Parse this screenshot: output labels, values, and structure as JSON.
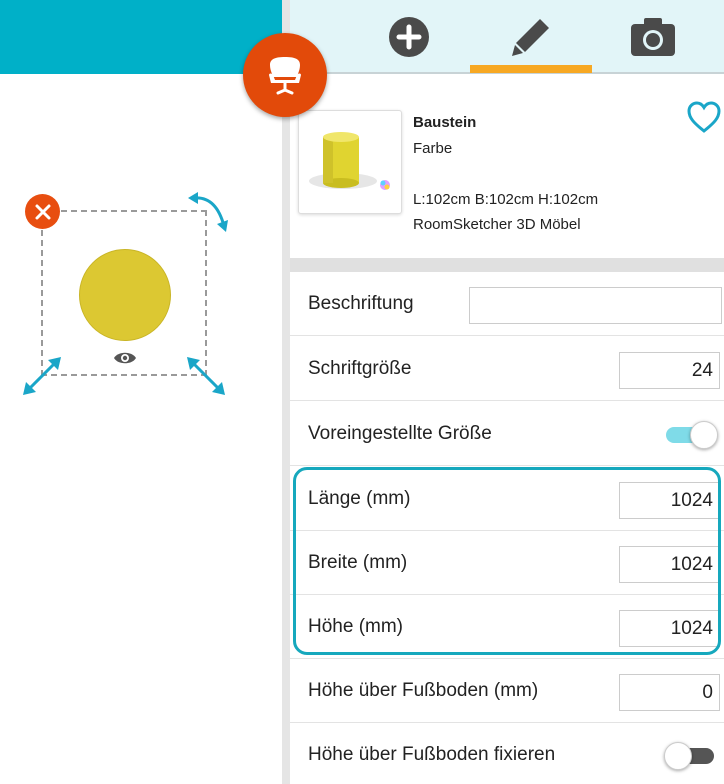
{
  "tabs": [
    {
      "icon": "plus-icon"
    },
    {
      "icon": "pencil-icon",
      "active": true
    },
    {
      "icon": "camera-icon"
    }
  ],
  "item": {
    "title": "Baustein",
    "subtitle": "Farbe",
    "dimensions": "L:102cm B:102cm H:102cm",
    "source": "RoomSketcher 3D Möbel",
    "color": "#dcc832"
  },
  "properties": {
    "beschriftung": {
      "label": "Beschriftung",
      "value": ""
    },
    "schriftgroesse": {
      "label": "Schriftgröße",
      "value": "24"
    },
    "voreingestellte_groesse": {
      "label": "Voreingestellte Größe",
      "toggle": true
    },
    "laenge": {
      "label": "Länge (mm)",
      "value": "1024"
    },
    "breite": {
      "label": "Breite (mm)",
      "value": "1024"
    },
    "hoehe": {
      "label": "Höhe (mm)",
      "value": "1024"
    },
    "hoehe_ueber_fussboden": {
      "label": "Höhe über Fußboden (mm)",
      "value": "0"
    },
    "hoehe_fixieren": {
      "label": "Höhe über Fußboden fixieren",
      "toggle": false
    }
  },
  "colors": {
    "accent": "#00b0c8",
    "active_tab": "#f7a823",
    "delete": "#e84e10",
    "furniture_button": "#e24a0a",
    "highlight": "#16a8bd"
  }
}
